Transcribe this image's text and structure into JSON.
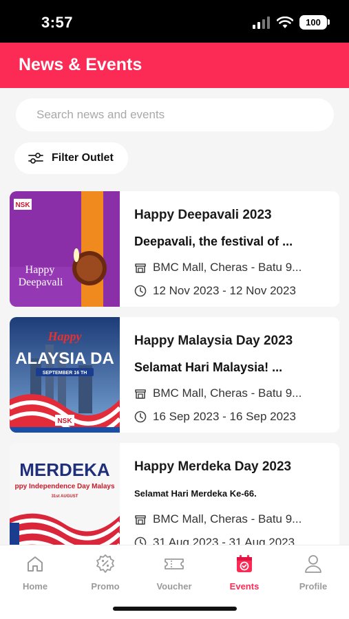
{
  "status_bar": {
    "time": "3:57",
    "battery": "100"
  },
  "header": {
    "title": "News & Events"
  },
  "search": {
    "placeholder": "Search news and events"
  },
  "filter": {
    "label": "Filter Outlet"
  },
  "events": [
    {
      "title": "Happy Deepavali 2023",
      "description": "Deepavali, the festival of ...",
      "location": "BMC Mall, Cheras - Batu 9...",
      "dates": "12 Nov 2023 - 12 Nov 2023",
      "image_text": {
        "brand": "NSK",
        "line1": "Happy",
        "line2": "Deepavali"
      }
    },
    {
      "title": "Happy Malaysia Day 2023",
      "description": "Selamat Hari Malaysia! ...",
      "location": "BMC Mall, Cheras - Batu 9...",
      "dates": "16 Sep 2023 - 16 Sep 2023",
      "image_text": {
        "script": "Happy",
        "headline": "ALAYSIA DA",
        "banner": "SEPTEMBER 16 TH",
        "brand": "NSK"
      }
    },
    {
      "title": "Happy Merdeka Day 2023",
      "description": "Selamat Hari Merdeka Ke-66.",
      "location": "BMC Mall, Cheras - Batu 9...",
      "dates": "31 Aug 2023 - 31 Aug 2023",
      "image_text": {
        "headline": "MERDEKA",
        "line1": "ppy Independence Day Malays",
        "line2": "31st AUGUST"
      }
    }
  ],
  "tabs": [
    {
      "label": "Home",
      "icon": "home-icon",
      "active": false
    },
    {
      "label": "Promo",
      "icon": "promo-icon",
      "active": false
    },
    {
      "label": "Voucher",
      "icon": "voucher-icon",
      "active": false
    },
    {
      "label": "Events",
      "icon": "events-icon",
      "active": true
    },
    {
      "label": "Profile",
      "icon": "profile-icon",
      "active": false
    }
  ],
  "colors": {
    "accent": "#fb2b55",
    "inactive": "#9a9a9a"
  }
}
